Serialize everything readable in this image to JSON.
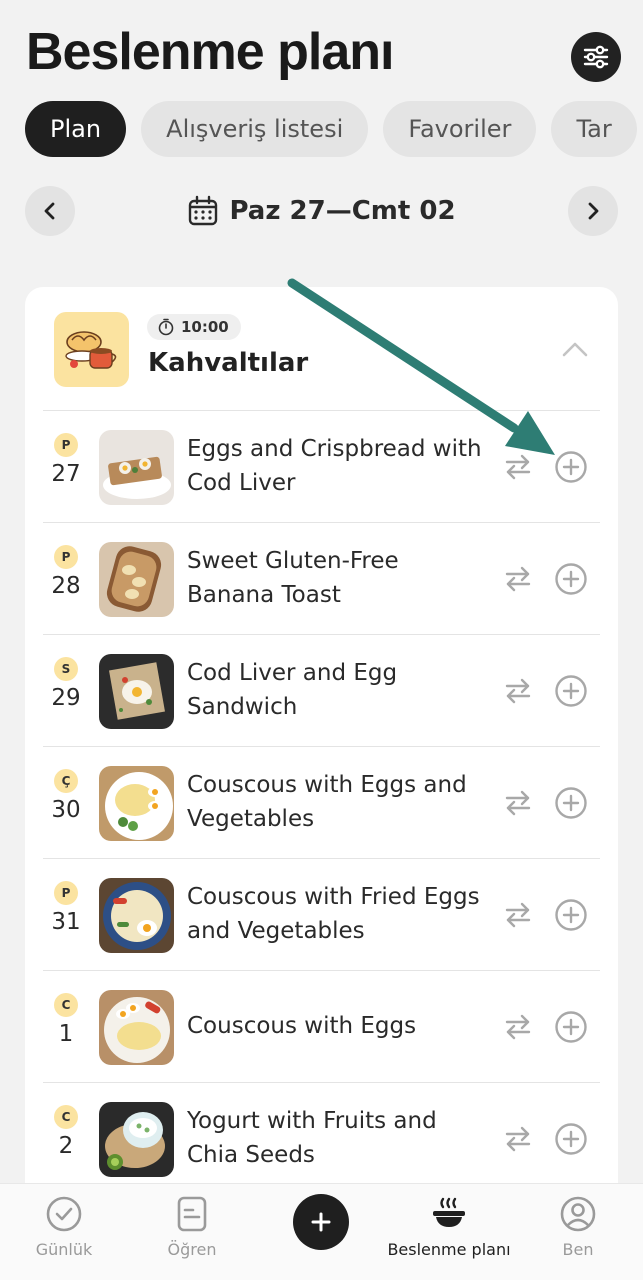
{
  "header": {
    "title": "Beslenme planı",
    "filter_icon": "sliders-icon"
  },
  "tabs": [
    {
      "label": "Plan",
      "active": true
    },
    {
      "label": "Alışveriş listesi",
      "active": false
    },
    {
      "label": "Favoriler",
      "active": false
    },
    {
      "label": "Tar",
      "active": false
    }
  ],
  "week": {
    "range": "Paz 27—Cmt 02",
    "prev_icon": "chevron-left-icon",
    "next_icon": "chevron-right-icon",
    "calendar_icon": "calendar-icon"
  },
  "meal": {
    "time": "10:00",
    "title": "Kahvaltılar",
    "timer_icon": "stopwatch-icon"
  },
  "recipes": [
    {
      "day_letter": "P",
      "day_num": "27",
      "name": "Eggs and Crispbread with Cod Liver"
    },
    {
      "day_letter": "P",
      "day_num": "28",
      "name": "Sweet Gluten-Free Banana Toast"
    },
    {
      "day_letter": "S",
      "day_num": "29",
      "name": "Cod Liver and Egg Sandwich"
    },
    {
      "day_letter": "Ç",
      "day_num": "30",
      "name": "Couscous with Eggs and Vegetables"
    },
    {
      "day_letter": "P",
      "day_num": "31",
      "name": "Couscous with Fried Eggs and Vegetables"
    },
    {
      "day_letter": "C",
      "day_num": "1",
      "name": "Couscous with Eggs"
    },
    {
      "day_letter": "C",
      "day_num": "2",
      "name": "Yogurt with Fruits and Chia Seeds"
    }
  ],
  "bottom_nav": [
    {
      "label": "Günlük",
      "icon": "check-circle-icon",
      "active": false
    },
    {
      "label": "Öğren",
      "icon": "book-icon",
      "active": false
    },
    {
      "label": "",
      "icon": "plus-icon",
      "active": false
    },
    {
      "label": "Beslenme planı",
      "icon": "food-bowl-icon",
      "active": true
    },
    {
      "label": "Ben",
      "icon": "user-profile-icon",
      "active": false
    }
  ],
  "colors": {
    "accent_arrow": "#2e7d74",
    "badge_yellow": "#fbe3a0",
    "dark": "#1f1f1f"
  }
}
